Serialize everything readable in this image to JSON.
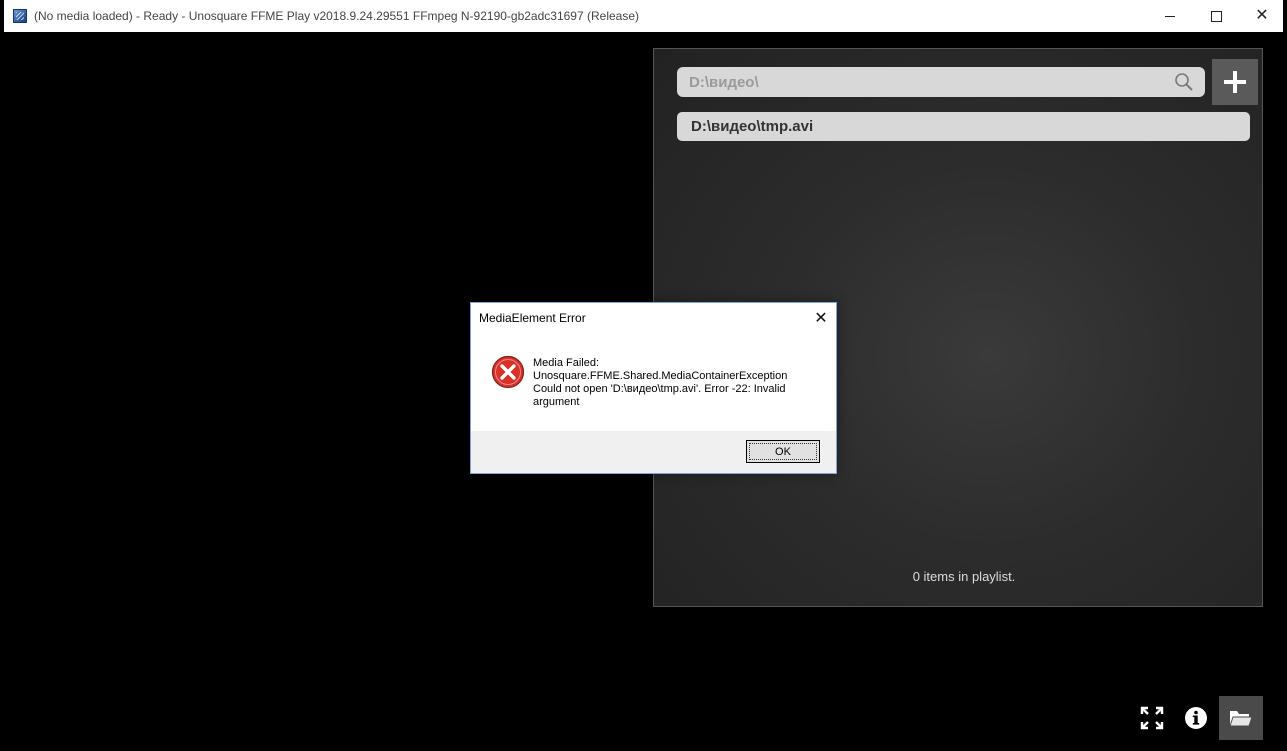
{
  "window": {
    "title": "(No media loaded) - Ready - Unosquare FFME Play v2018.9.24.29551 FFmpeg N-92190-gb2adc31697 (Release)",
    "controls": {
      "minimize": "minimize-icon",
      "maximize": "maximize-icon",
      "close": "close-icon"
    }
  },
  "playlist": {
    "search_value": "D:\\видео\\",
    "items": [
      {
        "label": "D:\\видео\\tmp.avi"
      }
    ],
    "count_text": "0 items in playlist."
  },
  "bottom_controls": {
    "icons": [
      "fullscreen-icon",
      "info-icon",
      "open-folder-icon"
    ]
  },
  "dialog": {
    "title": "MediaElement Error",
    "message_lines": [
      "Media Failed:",
      "Unosquare.FFME.Shared.MediaContainerException",
      "Could not open 'D:\\видео\\tmp.avi'. Error -22: Invalid",
      "argument"
    ],
    "ok_label": "OK",
    "icon": "error-icon"
  },
  "colors": {
    "panel_bg": "#2c2c2c",
    "field_bg": "#d8d8d8",
    "add_button_bg": "#5a5a5a",
    "error_red": "#d9302a"
  }
}
